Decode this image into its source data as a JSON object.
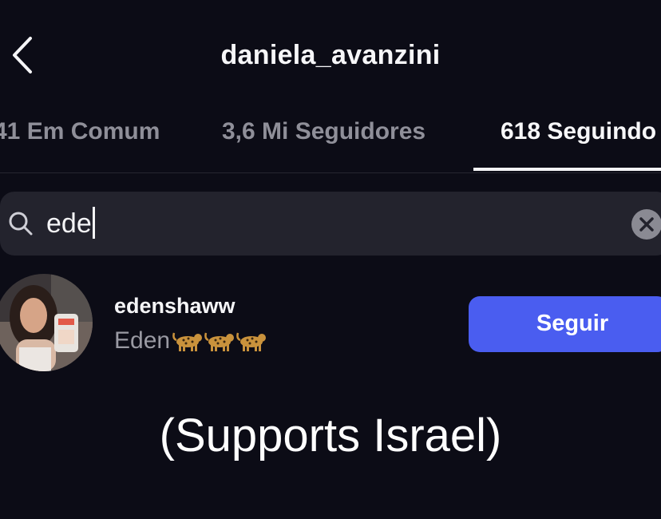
{
  "header": {
    "username": "daniela_avanzini"
  },
  "tabs": [
    {
      "label": "41 Em Comum",
      "active": false
    },
    {
      "label": "3,6 Mi Seguidores",
      "active": false
    },
    {
      "label": "618 Seguindo",
      "active": true
    }
  ],
  "search": {
    "value": "ede"
  },
  "results": [
    {
      "handle": "edenshaww",
      "display_name": "Eden",
      "name_emojis": [
        "leopard-emoji",
        "leopard-emoji",
        "leopard-emoji"
      ],
      "action_label": "Seguir"
    }
  ],
  "caption": "(Supports Israel)",
  "colors": {
    "background": "#0c0c16",
    "search_background": "#23232d",
    "follow_button": "#4a5df0",
    "muted_text": "#8f8f99"
  }
}
